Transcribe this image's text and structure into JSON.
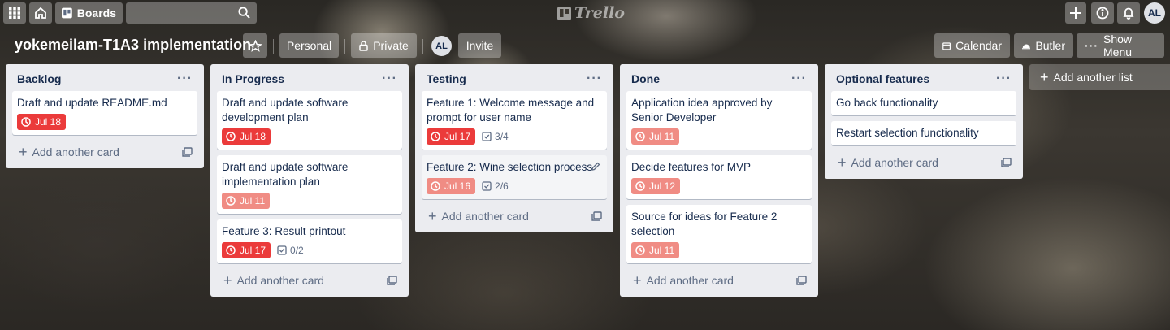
{
  "topnav": {
    "apps_icon": "grid-icon",
    "home_icon": "home-icon",
    "boards_label": "Boards",
    "search_value": "",
    "logo_text": "Trello",
    "avatar_initials": "AL"
  },
  "board": {
    "title": "yokemeilam-T1A3 implementation",
    "personal_label": "Personal",
    "private_label": "Private",
    "member_initials": "AL",
    "invite_label": "Invite",
    "calendar_label": "Calendar",
    "butler_label": "Butler",
    "show_menu_label": "Show Menu"
  },
  "add_card_label": "Add another card",
  "add_list_label": "Add another list",
  "colors": {
    "overdue": "#eb3b3b",
    "past_due": "#f08c84",
    "list_bg": "#ebecf0"
  },
  "lists": [
    {
      "title": "Backlog",
      "cards": [
        {
          "title": "Draft and update README.md",
          "due": "Jul 18",
          "due_status": "overdue"
        }
      ]
    },
    {
      "title": "In Progress",
      "cards": [
        {
          "title": "Draft and update software development plan",
          "due": "Jul 18",
          "due_status": "overdue"
        },
        {
          "title": "Draft and update software implementation plan",
          "due": "Jul 11",
          "due_status": "past"
        },
        {
          "title": "Feature 3: Result printout",
          "due": "Jul 17",
          "due_status": "overdue",
          "checklist": "0/2"
        }
      ]
    },
    {
      "title": "Testing",
      "cards": [
        {
          "title": "Feature 1: Welcome message and prompt for user name",
          "due": "Jul 17",
          "due_status": "overdue",
          "checklist": "3/4"
        },
        {
          "title": "Feature 2: Wine selection process",
          "due": "Jul 16",
          "due_status": "past",
          "checklist": "2/6"
        }
      ]
    },
    {
      "title": "Done",
      "cards": [
        {
          "title": "Application idea approved by Senior Developer",
          "due": "Jul 11",
          "due_status": "past"
        },
        {
          "title": "Decide features for MVP",
          "due": "Jul 12",
          "due_status": "past"
        },
        {
          "title": "Source for ideas for Feature 2 selection",
          "due": "Jul 11",
          "due_status": "past"
        }
      ]
    },
    {
      "title": "Optional features",
      "cards": [
        {
          "title": "Go back functionality"
        },
        {
          "title": "Restart selection functionality"
        }
      ]
    }
  ]
}
